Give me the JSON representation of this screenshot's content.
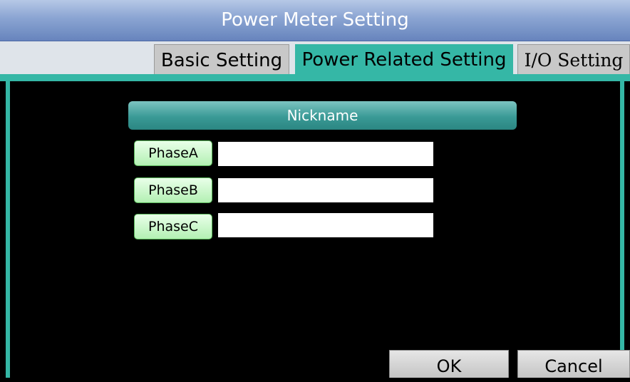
{
  "window": {
    "title": "Power Meter Setting"
  },
  "tabs": [
    {
      "label": "Basic Setting",
      "active": false
    },
    {
      "label": "Power Related Setting",
      "active": true
    },
    {
      "label": "I/O Setting",
      "active": false
    }
  ],
  "nickname": {
    "header": "Nickname",
    "phases": [
      {
        "label": "PhaseA",
        "value": ""
      },
      {
        "label": "PhaseB",
        "value": ""
      },
      {
        "label": "PhaseC",
        "value": ""
      }
    ]
  },
  "buttons": {
    "ok": "OK",
    "cancel": "Cancel"
  },
  "colors": {
    "accent_teal": "#35b7a6",
    "title_blue": "#8aa4d2",
    "phase_green": "#b3f0b3",
    "background": "#000000"
  }
}
